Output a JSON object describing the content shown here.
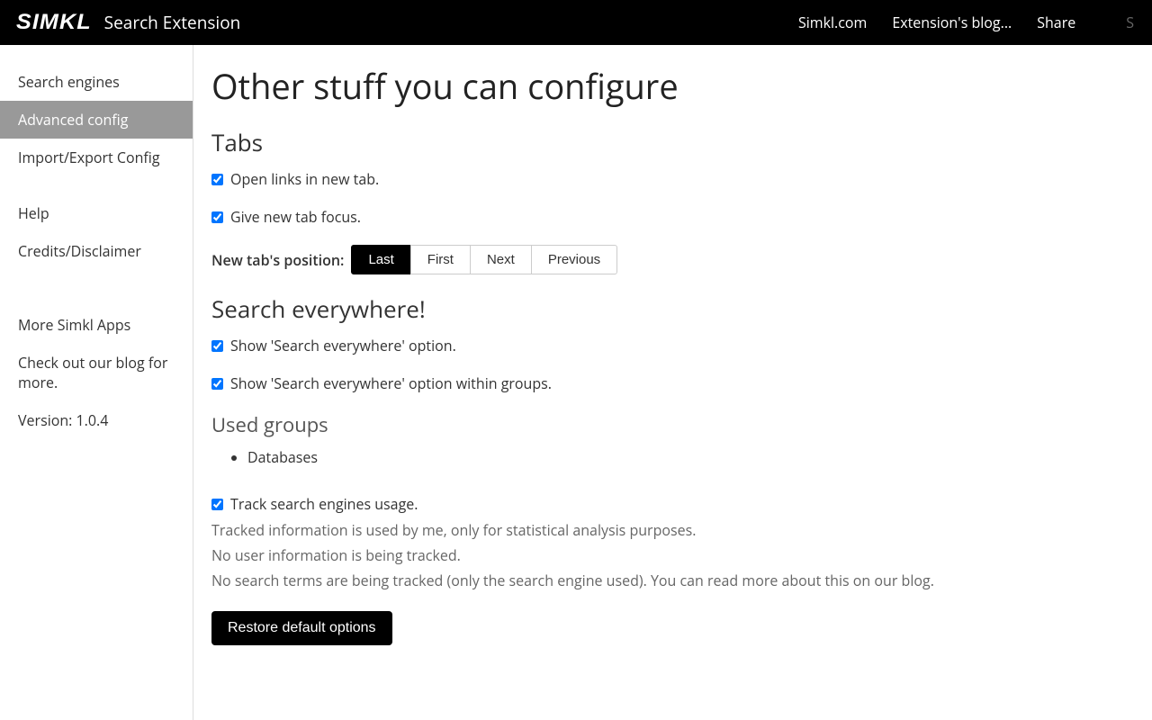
{
  "header": {
    "logo": "SIMKL",
    "title": "Search Extension",
    "links": {
      "simkl": "Simkl.com",
      "blog": "Extension's blog...",
      "share": "Share"
    },
    "trailing": "S"
  },
  "sidebar": {
    "items": [
      {
        "label": "Search engines",
        "active": false
      },
      {
        "label": "Advanced config",
        "active": true
      },
      {
        "label": "Import/Export Config",
        "active": false
      }
    ],
    "items2": [
      {
        "label": "Help"
      },
      {
        "label": "Credits/Disclaimer"
      }
    ],
    "info": {
      "more_apps": "More Simkl Apps",
      "blog_prompt": "Check out our blog for more.",
      "version": "Version: 1.0.4"
    }
  },
  "main": {
    "title": "Other stuff you can configure",
    "tabs_section": {
      "heading": "Tabs",
      "open_new_tab": "Open links in new tab.",
      "focus_new_tab": "Give new tab focus.",
      "position_label": "New tab's position:",
      "positions": [
        "Last",
        "First",
        "Next",
        "Previous"
      ],
      "active_position_index": 0
    },
    "search_section": {
      "heading": "Search everywhere!",
      "show_option": "Show 'Search everywhere' option.",
      "show_groups": "Show 'Search everywhere' option within groups.",
      "used_groups_heading": "Used groups",
      "used_groups": [
        "Databases"
      ]
    },
    "track_section": {
      "track_label": "Track search engines usage.",
      "info1": "Tracked information is used by me, only for statistical analysis purposes.",
      "info2": "No user information is being tracked.",
      "info3_prefix": "No search terms are being tracked (only the search engine used). You can read more about this on ",
      "info3_link": "our blog",
      "info3_suffix": "."
    },
    "restore_button": "Restore default options"
  }
}
